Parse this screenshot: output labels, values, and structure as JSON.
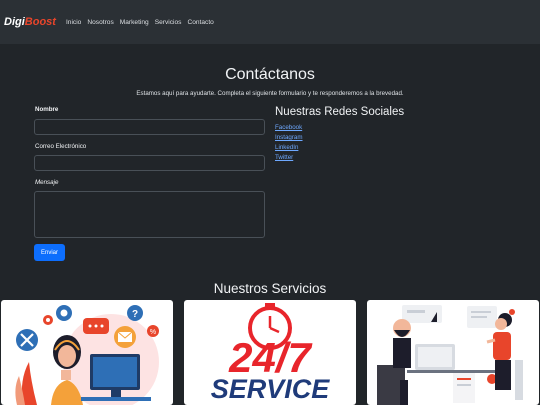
{
  "brand": {
    "part1": "Digi",
    "part2": "Boost"
  },
  "nav": {
    "items": [
      "Inicio",
      "Nosotros",
      "Marketing",
      "Servicios",
      "Contacto"
    ]
  },
  "contact": {
    "title": "Contáctanos",
    "subtitle": "Estamos aquí para ayudarte. Completa el siguiente formulario y te responderemos a la brevedad.",
    "name_label": "Nombre",
    "email_label": "Correo Electrónico",
    "message_label": "Mensaje",
    "submit_label": "Enviar"
  },
  "social": {
    "title": "Nuestras Redes Sociales",
    "links": [
      "Facebook",
      "Instagram",
      "LinkedIn",
      "Twitter"
    ]
  },
  "services": {
    "title": "Nuestros Servicios",
    "card2": {
      "big": "24/7",
      "word": "SERVICE"
    }
  },
  "colors": {
    "accent": "#0d6efd",
    "brand_red": "#e8452b",
    "bg": "#212529",
    "navbar": "#2b3035",
    "link": "#6ea8fe"
  }
}
